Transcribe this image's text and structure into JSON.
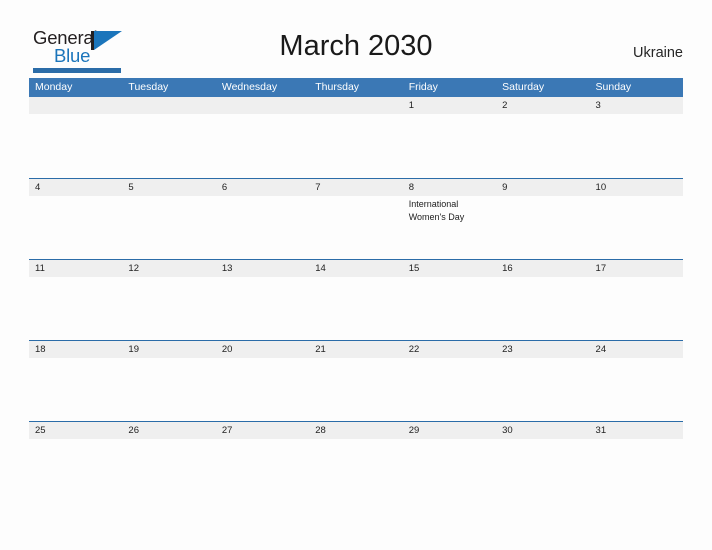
{
  "header": {
    "logo": {
      "text_primary": "General",
      "text_secondary": "Blue",
      "mark": "triangle-flag-mark"
    },
    "title": "March 2030",
    "country": "Ukraine"
  },
  "calendar": {
    "weekdays": [
      "Monday",
      "Tuesday",
      "Wednesday",
      "Thursday",
      "Friday",
      "Saturday",
      "Sunday"
    ],
    "colors": {
      "header_blue": "#3b78b5",
      "row_rule_blue": "#2b6ca8",
      "daynum_band": "#efefef",
      "logo_blue": "#1b75bb",
      "page_background": "#fdfdfd"
    },
    "weeks": [
      {
        "days": [
          {
            "num": "",
            "event": ""
          },
          {
            "num": "",
            "event": ""
          },
          {
            "num": "",
            "event": ""
          },
          {
            "num": "",
            "event": ""
          },
          {
            "num": "1",
            "event": ""
          },
          {
            "num": "2",
            "event": ""
          },
          {
            "num": "3",
            "event": ""
          }
        ]
      },
      {
        "days": [
          {
            "num": "4",
            "event": ""
          },
          {
            "num": "5",
            "event": ""
          },
          {
            "num": "6",
            "event": ""
          },
          {
            "num": "7",
            "event": ""
          },
          {
            "num": "8",
            "event": "International\nWomen's Day"
          },
          {
            "num": "9",
            "event": ""
          },
          {
            "num": "10",
            "event": ""
          }
        ]
      },
      {
        "days": [
          {
            "num": "11",
            "event": ""
          },
          {
            "num": "12",
            "event": ""
          },
          {
            "num": "13",
            "event": ""
          },
          {
            "num": "14",
            "event": ""
          },
          {
            "num": "15",
            "event": ""
          },
          {
            "num": "16",
            "event": ""
          },
          {
            "num": "17",
            "event": ""
          }
        ]
      },
      {
        "days": [
          {
            "num": "18",
            "event": ""
          },
          {
            "num": "19",
            "event": ""
          },
          {
            "num": "20",
            "event": ""
          },
          {
            "num": "21",
            "event": ""
          },
          {
            "num": "22",
            "event": ""
          },
          {
            "num": "23",
            "event": ""
          },
          {
            "num": "24",
            "event": ""
          }
        ]
      },
      {
        "days": [
          {
            "num": "25",
            "event": ""
          },
          {
            "num": "26",
            "event": ""
          },
          {
            "num": "27",
            "event": ""
          },
          {
            "num": "28",
            "event": ""
          },
          {
            "num": "29",
            "event": ""
          },
          {
            "num": "30",
            "event": ""
          },
          {
            "num": "31",
            "event": ""
          }
        ]
      }
    ]
  }
}
